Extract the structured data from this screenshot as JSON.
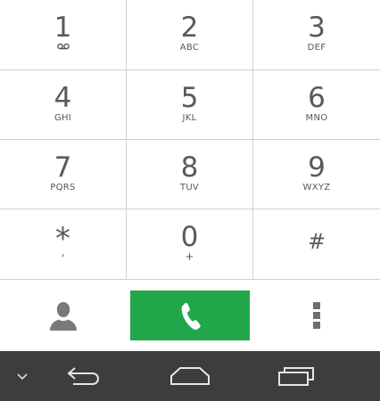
{
  "dialpad": {
    "keys": [
      {
        "digit": "1",
        "letters": "",
        "icon": "voicemail-icon"
      },
      {
        "digit": "2",
        "letters": "ABC"
      },
      {
        "digit": "3",
        "letters": "DEF"
      },
      {
        "digit": "4",
        "letters": "GHI"
      },
      {
        "digit": "5",
        "letters": "JKL"
      },
      {
        "digit": "6",
        "letters": "MNO"
      },
      {
        "digit": "7",
        "letters": "PQRS"
      },
      {
        "digit": "8",
        "letters": "TUV"
      },
      {
        "digit": "9",
        "letters": "WXYZ"
      },
      {
        "digit": "*",
        "letters": ","
      },
      {
        "digit": "0",
        "letters": "+"
      },
      {
        "digit": "#",
        "letters": ""
      }
    ]
  },
  "actions": {
    "contacts_icon": "person-icon",
    "call_icon": "phone-handset-icon",
    "menu_icon": "overflow-menu-icon",
    "call_color": "#22a64a"
  },
  "navbar": {
    "background": "#3d3d3d",
    "icons": [
      "chevron-down-icon",
      "back-icon",
      "home-icon",
      "recent-apps-icon"
    ]
  }
}
